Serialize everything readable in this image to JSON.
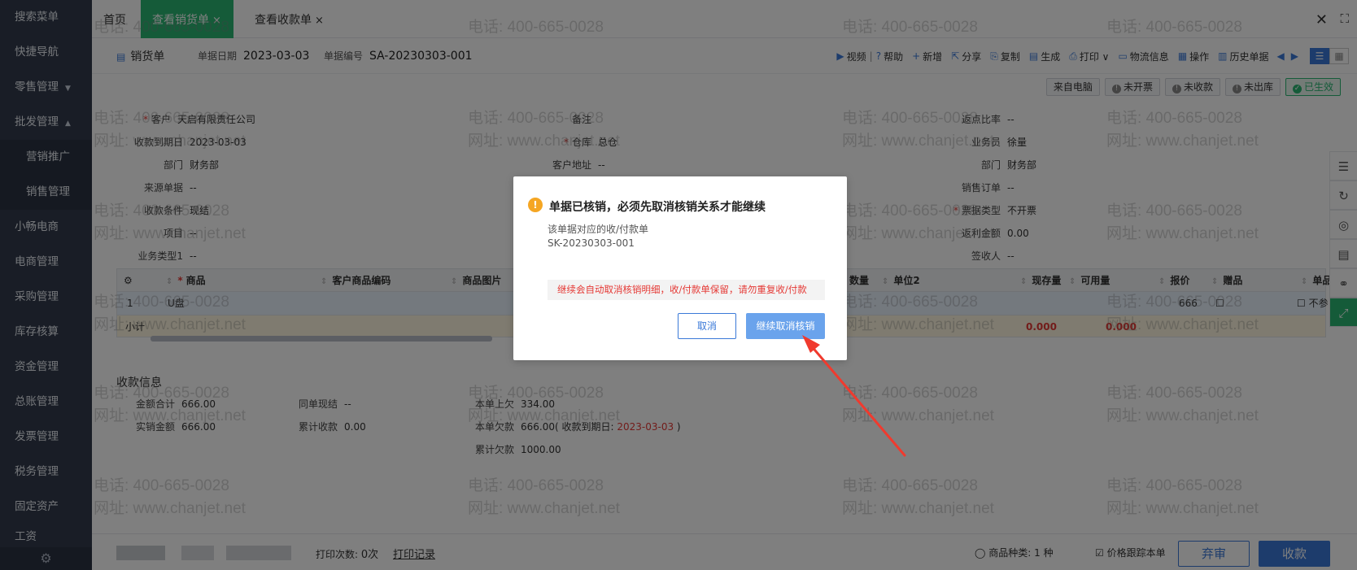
{
  "sidebar": {
    "items": [
      {
        "label": "搜索菜单"
      },
      {
        "label": "快捷导航"
      },
      {
        "label": "零售管理",
        "caret": "▼"
      },
      {
        "label": "批发管理",
        "caret": "▲"
      },
      {
        "label": "营销推广",
        "sub": true
      },
      {
        "label": "销售管理",
        "sub": true
      },
      {
        "label": "小畅电商"
      },
      {
        "label": "电商管理"
      },
      {
        "label": "采购管理"
      },
      {
        "label": "库存核算"
      },
      {
        "label": "资金管理"
      },
      {
        "label": "总账管理"
      },
      {
        "label": "发票管理"
      },
      {
        "label": "税务管理"
      },
      {
        "label": "固定资产"
      },
      {
        "label": "工资"
      }
    ]
  },
  "tabs": [
    {
      "label": "首页",
      "closable": false
    },
    {
      "label": "查看销货单",
      "closable": true,
      "active": true
    },
    {
      "label": "查看收款单",
      "closable": true
    }
  ],
  "tab_close_glyph": "×",
  "window": {
    "close": "✕",
    "max": "⛶"
  },
  "doc": {
    "title": "销货单",
    "date_label": "单据日期",
    "date": "2023-03-03",
    "no_label": "单据编号",
    "no": "SA-20230303-001"
  },
  "toolbar": [
    {
      "icon": "▶",
      "name": "video-icon",
      "label": "视频",
      "sep": true
    },
    {
      "icon": "?",
      "name": "help-icon",
      "label": "帮助"
    },
    {
      "icon": "+",
      "name": "add-icon",
      "label": "新增"
    },
    {
      "icon": "⇱",
      "name": "share-icon",
      "label": "分享"
    },
    {
      "icon": "⎘",
      "name": "copy-icon",
      "label": "复制"
    },
    {
      "icon": "▤",
      "name": "generate-icon",
      "label": "生成"
    },
    {
      "icon": "⎙",
      "name": "print-icon",
      "label": "打印 ∨"
    },
    {
      "icon": "▭",
      "name": "logistics-icon",
      "label": "物流信息"
    },
    {
      "icon": "▦",
      "name": "operate-icon",
      "label": "操作"
    },
    {
      "icon": "▥",
      "name": "history-icon",
      "label": "历史单据"
    }
  ],
  "nav": {
    "prev": "◀",
    "next": "▶"
  },
  "badges": [
    {
      "label": "来自电脑",
      "icon": ""
    },
    {
      "label": "未开票",
      "icon": "!"
    },
    {
      "label": "未收款",
      "icon": "!"
    },
    {
      "label": "未出库",
      "icon": "!"
    },
    {
      "label": "已生效",
      "icon": "✓",
      "ok": true
    }
  ],
  "form": {
    "customer_label": "客户",
    "customer": "天启有限责任公司",
    "due_label": "收款到期日",
    "due": "2023-03-03",
    "dept_label": "部门",
    "dept": "财务部",
    "source_label": "来源单据",
    "source": "--",
    "terms_label": "收款条件",
    "terms": "现结",
    "project_label": "项目",
    "project": "--",
    "biztype_label": "业务类型1",
    "biztype": "--",
    "remark_label": "备注",
    "warehouse_label": "仓库",
    "warehouse": "总仓",
    "addr_label": "客户地址",
    "addr": "--",
    "rebate_rate_label": "返点比率",
    "rebate_rate": "--",
    "salesman_label": "业务员",
    "salesman": "徐量",
    "dept2_label": "部门",
    "dept2": "财务部",
    "order_label": "销售订单",
    "order": "--",
    "invoice_label": "票据类型",
    "invoice": "不开票",
    "rebate_amt_label": "返利金额",
    "rebate_amt": "0.00",
    "receiver_label": "签收人",
    "receiver": "--"
  },
  "grid": {
    "headers": [
      "商品",
      "客户商品编码",
      "商品图片",
      "数量",
      "单位2",
      "现存量",
      "可用量",
      "报价",
      "赠品",
      "单品"
    ],
    "row": {
      "idx": "1",
      "product": "U盘",
      "price": "666",
      "last": "不参"
    },
    "subtotal": {
      "label": "小计",
      "stock": "0.000",
      "avail": "0.000"
    }
  },
  "payment": {
    "title": "收款信息",
    "total_label": "金额合计",
    "total": "666.00",
    "actual_label": "实销金额",
    "actual": "666.00",
    "same_label": "同单现结",
    "same": "--",
    "cum_label": "累计收款",
    "cum": "0.00",
    "prev_label": "本单上欠",
    "prev": "334.00",
    "owe_label": "本单欠款",
    "owe": "666.00",
    "owe_due_prefix": "( 收款到期日: ",
    "owe_due": "2023-03-03",
    "owe_due_suffix": " )",
    "cum_owe_label": "累计欠款",
    "cum_owe": "1000.00"
  },
  "bottom": {
    "print_count_label": "打印次数:",
    "print_count": "0次",
    "print_log": "打印记录",
    "kinds_label": "商品种类:",
    "kinds": "1 种",
    "track_label": "价格跟踪本单",
    "discard": "弃审",
    "collect": "收款"
  },
  "dialog": {
    "warn_glyph": "!",
    "title": "单据已核销，必须先取消核销关系才能继续",
    "subtitle": "该单据对应的收/付款单",
    "doc_no": "SK-20230303-001",
    "note": "继续会自动取消核销明细，收/付款单保留，请勿重复收/付款",
    "cancel": "取消",
    "confirm": "继续取消核销"
  },
  "watermark": {
    "phone": "电话: 400-665-0028",
    "site": "网址: www.chanjet.net"
  },
  "colors": {
    "accent": "#3a79d8",
    "green": "#2bb673",
    "red": "#e53935",
    "sidebar": "#323b4d",
    "arrow": "#f03a2e"
  }
}
